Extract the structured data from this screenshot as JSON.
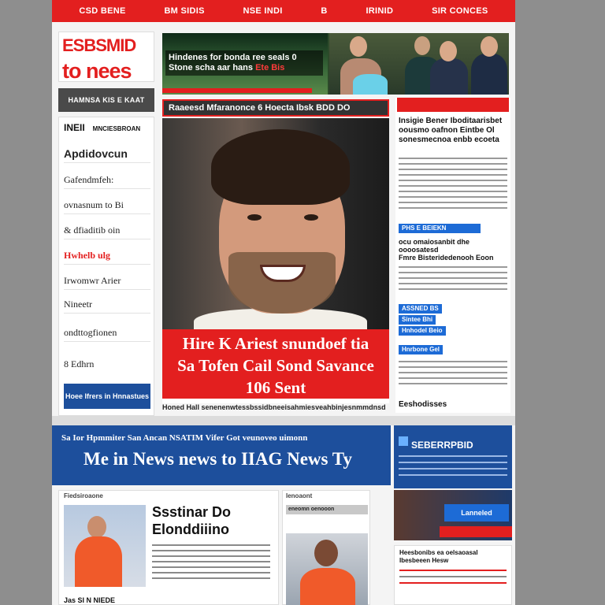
{
  "topnav": {
    "items": [
      "CSD BENE",
      "BM SIDIS",
      "NSE INDI",
      "B",
      "IRINID",
      "SIR CONCES"
    ]
  },
  "logo": {
    "line1": "ESBSMID",
    "line2": "to nees"
  },
  "top_strip": {
    "caption": "Hindenes for bonda ree seals 0 Stone scha aar hans",
    "caption_highlight": "Ete Bis"
  },
  "section_header": "HAMNSA KIS E KAAT",
  "sidebar": {
    "label": "INEII",
    "label_small": "MNCIESBROAN",
    "items": [
      {
        "label": "Apdidovcun",
        "style": "big"
      },
      {
        "label": "Gafendmfeh:",
        "style": ""
      },
      {
        "label": "ovnasnum to Bi",
        "style": ""
      },
      {
        "label": "& dfiaditib oin",
        "style": ""
      },
      {
        "label": "Hwhelb ulg",
        "style": "hl"
      },
      {
        "label": "Irwomwr Arier",
        "style": ""
      },
      {
        "label": "Nineetr",
        "style": ""
      },
      {
        "label": "ondttogfionen",
        "style": ""
      },
      {
        "label": "8 Edhrn",
        "style": ""
      }
    ],
    "button": "Hoee Ifrers in Hnnastues"
  },
  "feature": {
    "header": "Raaeesd Mfaranonce 6 Hoecta Ibsk BDD DO",
    "title_line1": "Hire K Ariest snundoef tia",
    "title_line2": "Sa Tofen Cail Sond Savance",
    "title_line3": "106 Sent",
    "byline": "Honed Hall senenenwtessbssidbneeisahmiesveahbinjesnmmdnsd"
  },
  "right_col": {
    "title": "Insigie Bener Iboditaarisbet oousmo oafnon Eintbe Ol sonesmecnoa enbb ecoeta",
    "tag1": "PHS E BEIEKN",
    "head2": "ocu omaiosanbit dhe oooosatesd",
    "head3": "Fmre Bisteridedenooh Eoon",
    "tag2": "ASSNED BS",
    "tag3": "Sintee Bhi",
    "tag4": "Hnhodel Beio",
    "tag5": "Hnrbone Gel",
    "foot": "Eeshodisses"
  },
  "banner": {
    "line1": "Sa Ior Hpmmiter San Ancan NSATIM Vifer Got veunoveo uimonn",
    "line2": "Me in News news to IIAG News Ty"
  },
  "promo": {
    "title": "SEBERRPBID",
    "tag": "Lanneled"
  },
  "card1": {
    "label": "Fiedsiroaone",
    "title_line1": "Ssstinar Do",
    "title_line2": "Elonddiiino",
    "foot": "Jas SI N NIEDE"
  },
  "card2": {
    "label": "Ienoaont",
    "label2": "eneomn oenooon"
  },
  "card3": {
    "title": "Heesbonibs ea oelsaoasal Ibesbeeen Hesw"
  },
  "colors": {
    "accent_red": "#e31f1f",
    "accent_blue": "#1d4f9c",
    "tag_blue": "#1d6bd6"
  }
}
